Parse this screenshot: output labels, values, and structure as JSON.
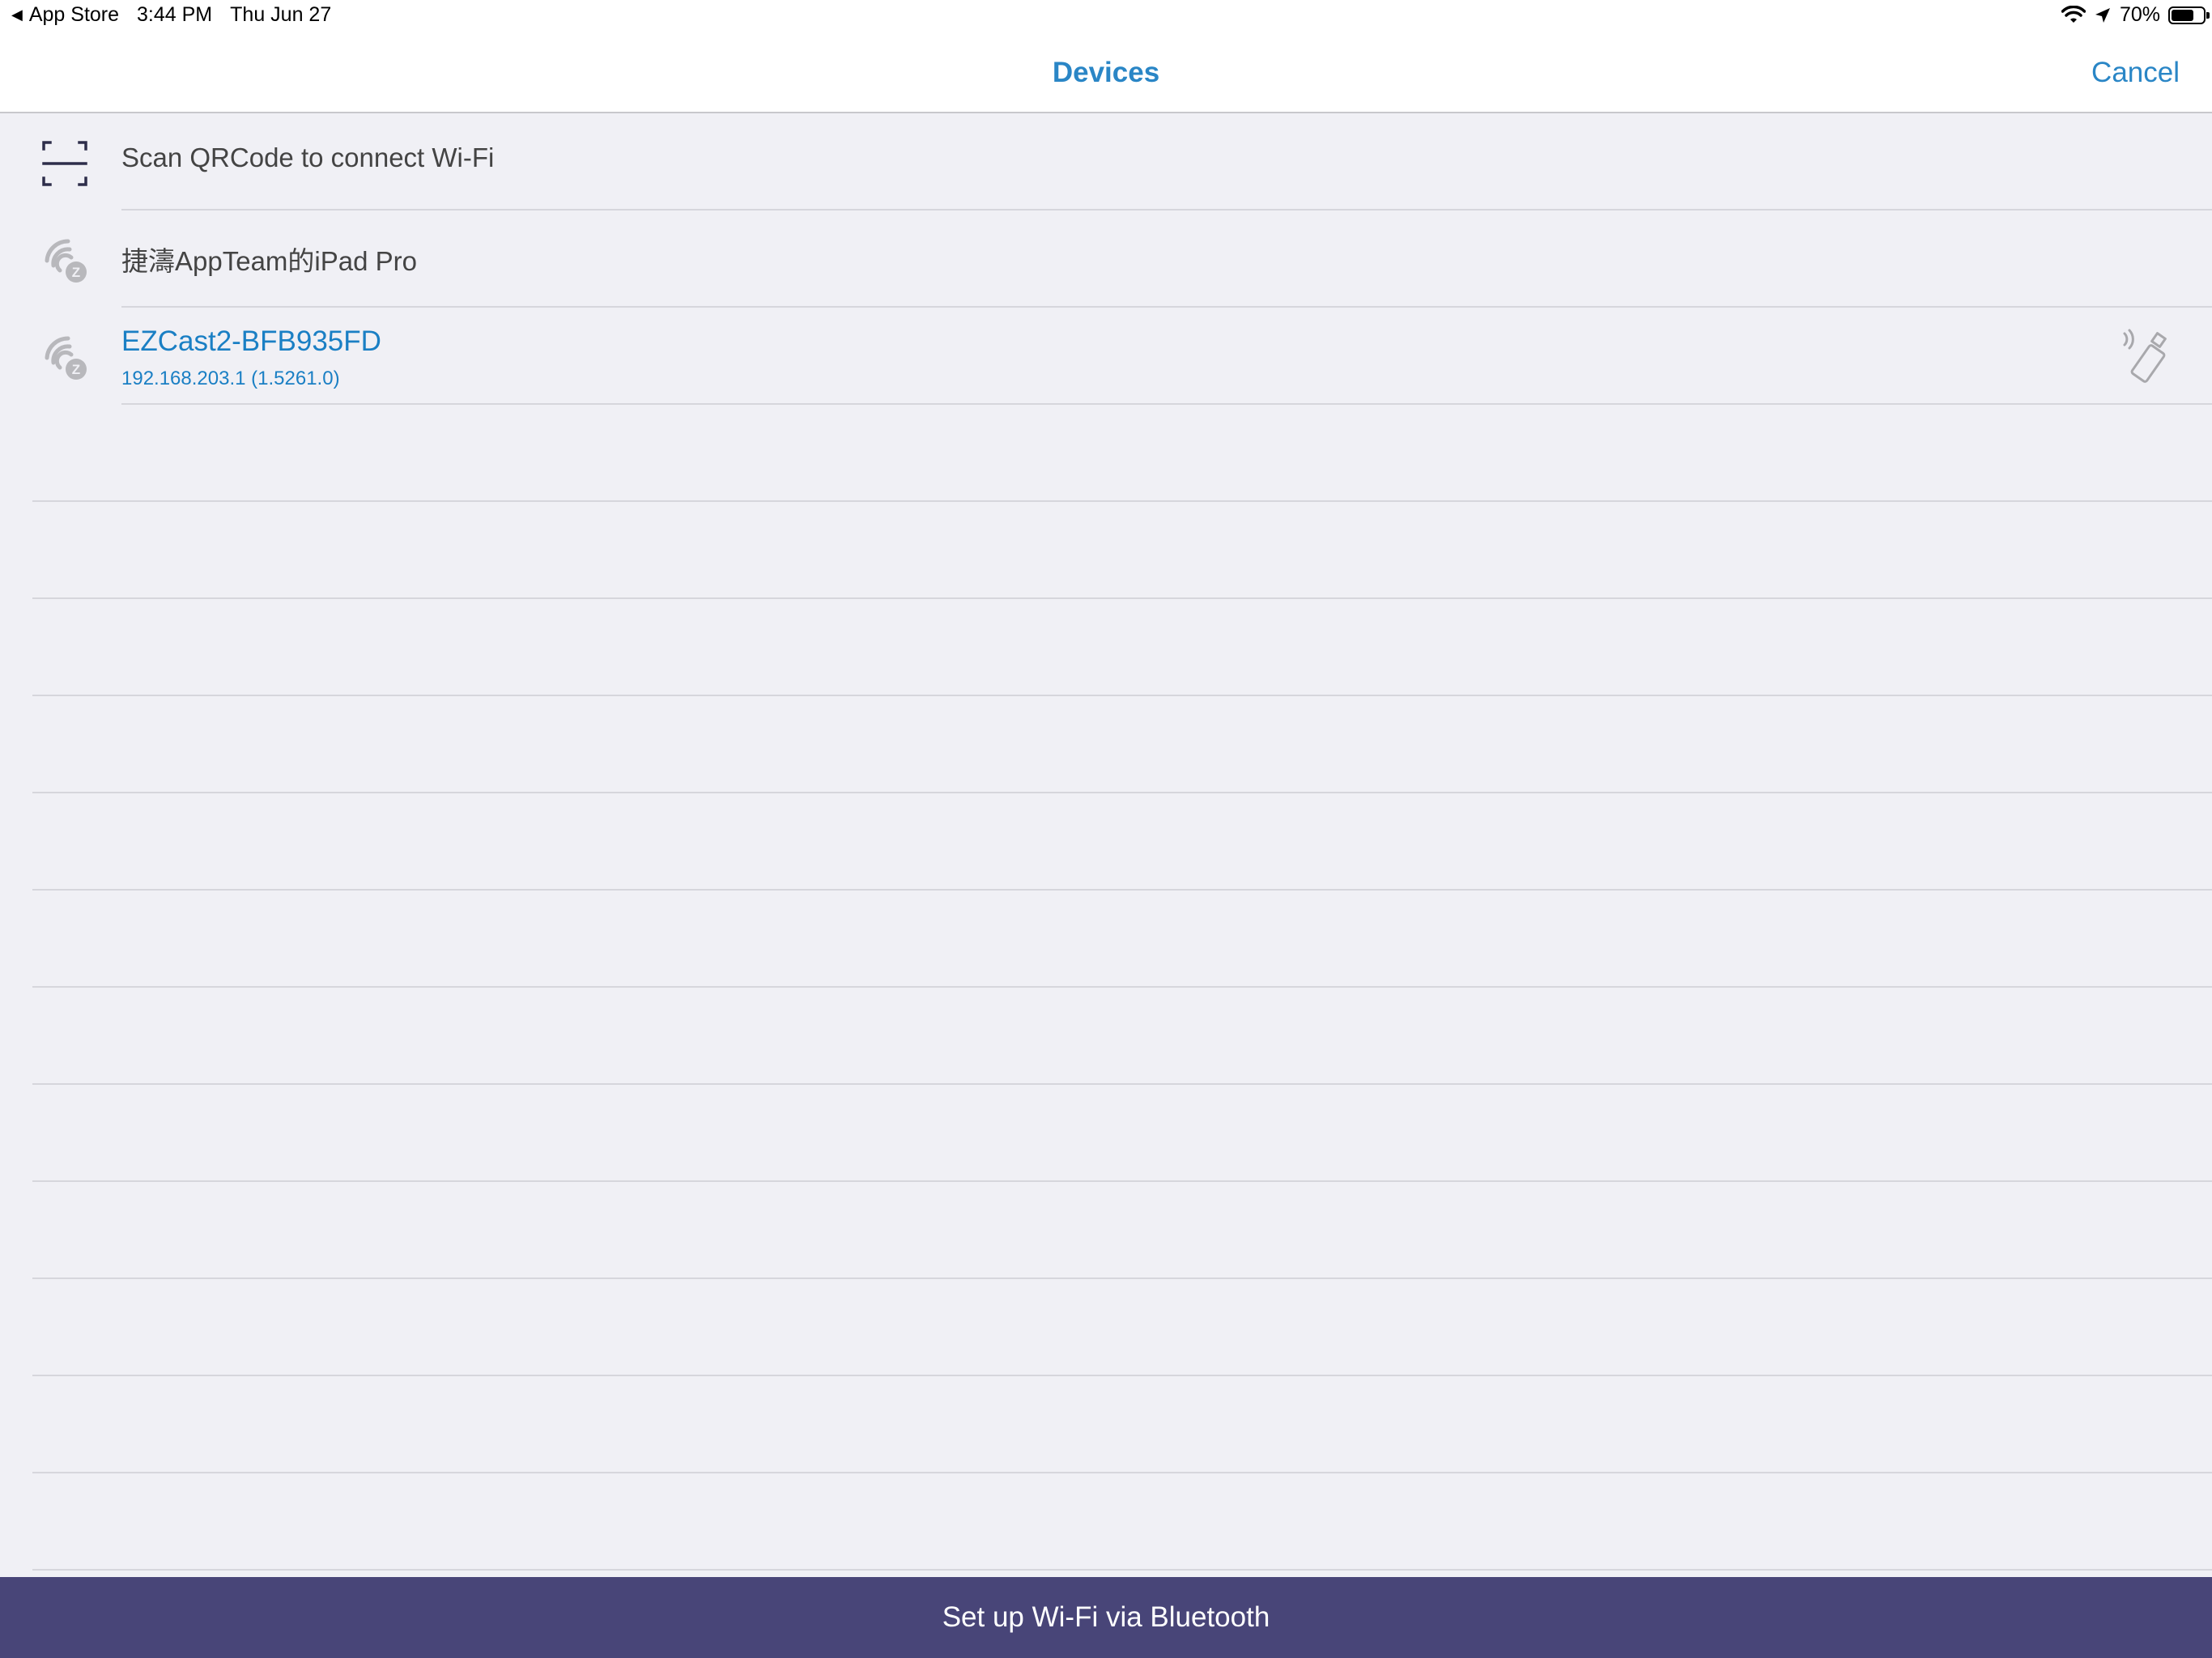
{
  "status_bar": {
    "back_label": "App Store",
    "time": "3:44 PM",
    "date": "Thu Jun 27",
    "battery_percent": "70%",
    "battery_level": 0.7
  },
  "nav": {
    "title": "Devices",
    "cancel_label": "Cancel"
  },
  "list": {
    "scan_label": "Scan QRCode to connect Wi-Fi",
    "local_device_label": "捷濤AppTeam的iPad Pro",
    "device": {
      "name": "EZCast2-BFB935FD",
      "detail": "192.168.203.1 (1.5261.0)"
    }
  },
  "bottom_button": {
    "label": "Set up Wi-Fi via Bluetooth"
  },
  "colors": {
    "accent": "#2a86c6",
    "bottom_bar": "#484578",
    "background": "#f0f0f5"
  },
  "icons": {
    "scan": "qr-scan-icon",
    "cast": "ezcast-signal-icon",
    "dongle": "dongle-signal-icon"
  }
}
